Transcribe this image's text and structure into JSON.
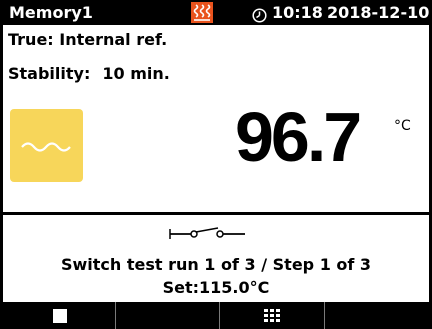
{
  "status_bar": {
    "program_name": "Memory1",
    "heating_icon": "heating-icon",
    "clock_icon": "clock-icon",
    "time": "10:18",
    "date": "2018-12-10"
  },
  "info": {
    "reference": "True: Internal ref.",
    "stability_label": "Stability:",
    "stability_value": "10 min."
  },
  "stability_indicator": {
    "icon": "wave-icon",
    "color": "#f7d65a"
  },
  "reading": {
    "value": "96.7",
    "unit": "°C"
  },
  "test": {
    "switch_icon": "switch-icon",
    "run_status": "Switch test run 1 of 3 / Step 1 of 3",
    "setpoint": "Set:115.0°C"
  },
  "softkeys": [
    {
      "icon": "stop-icon"
    },
    {
      "icon": ""
    },
    {
      "icon": "grid-icon"
    },
    {
      "icon": ""
    }
  ],
  "colors": {
    "heating": "#e9531d",
    "background": "#000000",
    "panel": "#ffffff"
  }
}
